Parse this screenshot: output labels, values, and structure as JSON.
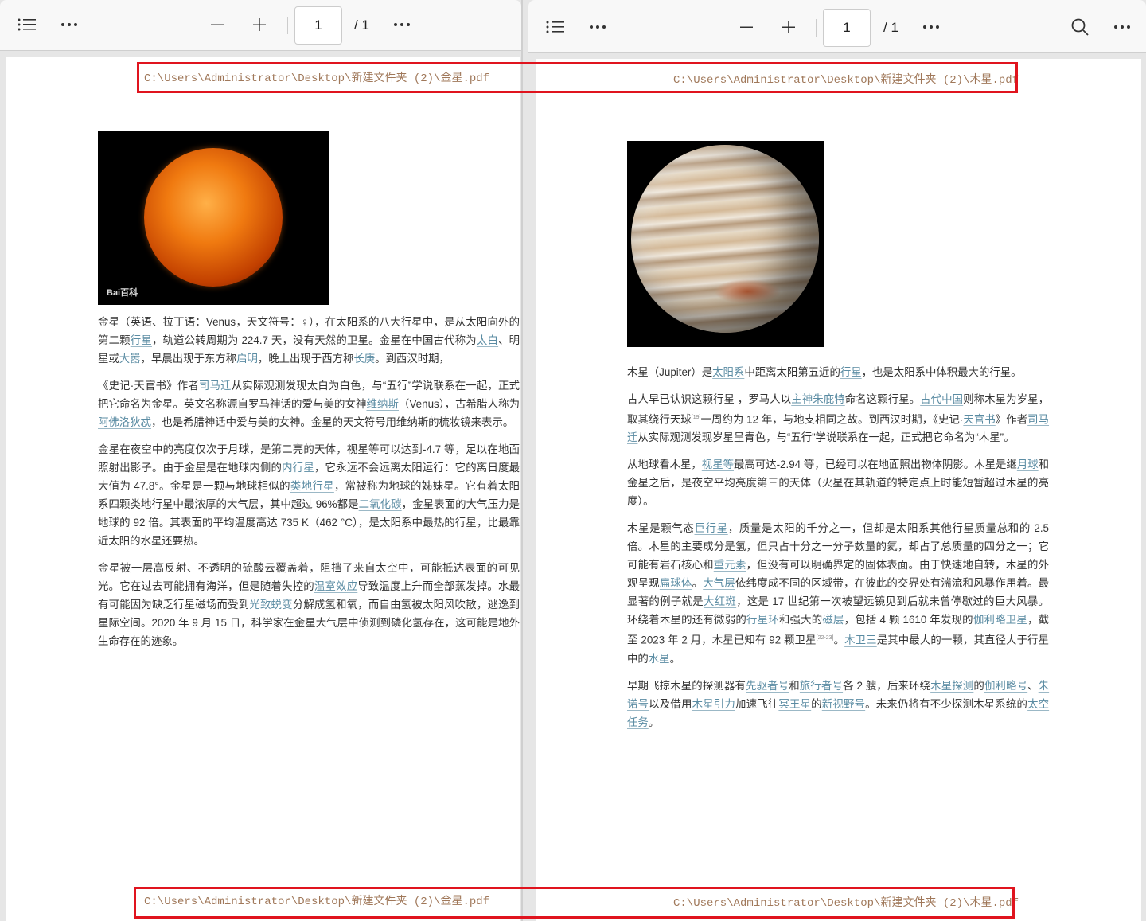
{
  "left": {
    "toolbar": {
      "page_value": "1",
      "page_total": "/ 1"
    },
    "path": "C:\\Users\\Administrator\\Desktop\\新建文件夹 (2)\\金星.pdf",
    "image_watermark": "Bai百科",
    "paragraphs": [
      [
        {
          "t": "金星（英语、拉丁语：Venus，天文符号：♀），在太阳系的八大行星中，是从太阳向外的第二颗"
        },
        {
          "t": "行星",
          "link": true
        },
        {
          "t": "，轨道公转周期为 224.7 天，没有天然的卫星。金星在中国古代称为"
        },
        {
          "t": "太白",
          "link": true
        },
        {
          "t": "、明星或"
        },
        {
          "t": "大嚣",
          "link": true
        },
        {
          "t": "，早晨出现于东方称"
        },
        {
          "t": "启明",
          "link": true
        },
        {
          "t": "，晚上出现于西方称"
        },
        {
          "t": "长庚",
          "link": true
        },
        {
          "t": "。到西汉时期，"
        }
      ],
      [
        {
          "t": "《史记·天官书》作者"
        },
        {
          "t": "司马迁",
          "link": true
        },
        {
          "t": "从实际观测发现太白为白色，与“五行”学说联系在一起，正式把它命名为金星。英文名称源自罗马神话的爱与美的女神"
        },
        {
          "t": "维纳斯",
          "link": true
        },
        {
          "t": "（Venus），古希腊人称为"
        },
        {
          "t": "阿佛洛狄忒",
          "link": true
        },
        {
          "t": "，也是希腊神话中爱与美的女神。金星的天文符号用维纳斯的梳妆镜来表示。"
        }
      ],
      [
        {
          "t": "金星在夜空中的亮度仅次于月球，是第二亮的天体，视星等可以达到-4.7 等，足以在地面照射出影子。由于金星是在地球内侧的"
        },
        {
          "t": "内行星",
          "link": true
        },
        {
          "t": "，它永远不会远离太阳运行：它的离日度最大值为 47.8°。金星是一颗与地球相似的"
        },
        {
          "t": "类地行星",
          "link": true
        },
        {
          "t": "，常被称为地球的姊妹星。它有着太阳系四颗类地行星中最浓厚的大气层，其中超过 96%都是"
        },
        {
          "t": "二氧化碳",
          "link": true
        },
        {
          "t": "，金星表面的大气压力是地球的 92 倍。其表面的平均温度高达 735 K（462 °C），是太阳系中最热的行星，比最靠近太阳的水星还要热。"
        }
      ],
      [
        {
          "t": "金星被一层高反射、不透明的硫酸云覆盖着，阻挡了来自太空中，可能抵达表面的可见光。它在过去可能拥有海洋，但是随着失控的"
        },
        {
          "t": "温室效应",
          "link": true
        },
        {
          "t": "导致温度上升而全部蒸发掉。水最有可能因为缺乏行星磁场而受到"
        },
        {
          "t": "光致蜕变",
          "link": true
        },
        {
          "t": "分解成氢和氧，而自由氢被太阳风吹散，逃逸到星际空间。2020 年 9 月 15 日，科学家在金星大气层中侦测到磷化氢存在，这可能是地外生命存在的迹象。"
        }
      ]
    ]
  },
  "right": {
    "toolbar": {
      "page_value": "1",
      "page_total": "/ 1"
    },
    "path": "C:\\Users\\Administrator\\Desktop\\新建文件夹 (2)\\木星.pdf",
    "paragraphs": [
      [
        {
          "t": "木星（Jupiter）是"
        },
        {
          "t": "太阳系",
          "link": true
        },
        {
          "t": "中距离太阳第五近的"
        },
        {
          "t": "行星",
          "link": true
        },
        {
          "t": "，也是太阳系中体积最大的行星。"
        }
      ],
      [
        {
          "t": "古人早已认识这颗行星 ，罗马人以"
        },
        {
          "t": "主神朱庇特",
          "link": true
        },
        {
          "t": "命名这颗行星。"
        },
        {
          "t": "古代中国",
          "link": true
        },
        {
          "t": "则称木星为岁星，取其绕行天球"
        },
        {
          "t": "[19]",
          "sup": true
        },
        {
          "t": "一周约为 12 年，与地支相同之故。到西汉时期，《史记·"
        },
        {
          "t": "天官书",
          "link": true
        },
        {
          "t": "》作者"
        },
        {
          "t": "司马迁",
          "link": true
        },
        {
          "t": "从实际观测发现岁星呈青色，与“五行”学说联系在一起，正式把它命名为“木星”。"
        }
      ],
      [
        {
          "t": "从地球看木星，"
        },
        {
          "t": "视星等",
          "link": true
        },
        {
          "t": "最高可达-2.94 等，已经可以在地面照出物体阴影。木星是继"
        },
        {
          "t": "月球",
          "link": true
        },
        {
          "t": "和金星之后，是夜空平均亮度第三的天体（火星在其轨道的特定点上时能短暂超过木星的亮度）。"
        }
      ],
      [
        {
          "t": "木星是颗气态"
        },
        {
          "t": "巨行星",
          "link": true
        },
        {
          "t": "，质量是太阳的千分之一，但却是太阳系其他行星质量总和的 2.5 倍。木星的主要成分是氢，但只占十分之一分子数量的氦，却占了总质量的四分之一；它可能有岩石核心和"
        },
        {
          "t": "重元素",
          "link": true
        },
        {
          "t": "，但没有可以明确界定的固体表面。由于快速地自转，木星的外观呈现"
        },
        {
          "t": "扁球体",
          "link": true
        },
        {
          "t": "。"
        },
        {
          "t": "大气层",
          "link": true
        },
        {
          "t": "依纬度成不同的区域带，在彼此的交界处有湍流和风暴作用着。最显著的例子就是"
        },
        {
          "t": "大红斑",
          "link": true
        },
        {
          "t": "，这是 17 世纪第一次被望远镜见到后就未曾停歇过的巨大风暴。环绕着木星的还有微弱的"
        },
        {
          "t": "行星环",
          "link": true
        },
        {
          "t": "和强大的"
        },
        {
          "t": "磁层",
          "link": true
        },
        {
          "t": "，包括 4 颗 1610 年发现的"
        },
        {
          "t": "伽利略卫星",
          "link": true
        },
        {
          "t": "，截至 2023 年 2 月，木星已知有 92 颗卫星"
        },
        {
          "t": "[22-23]",
          "sup": true
        },
        {
          "t": "。"
        },
        {
          "t": "木卫三",
          "link": true
        },
        {
          "t": "是其中最大的一颗，其直径大于行星中的"
        },
        {
          "t": "水星",
          "link": true
        },
        {
          "t": "。"
        }
      ],
      [
        {
          "t": "早期飞掠木星的探测器有"
        },
        {
          "t": "先驱者号",
          "link": true
        },
        {
          "t": "和"
        },
        {
          "t": "旅行者号",
          "link": true
        },
        {
          "t": "各 2 艘，后来环绕"
        },
        {
          "t": "木星探测",
          "link": true
        },
        {
          "t": "的"
        },
        {
          "t": "伽利略号",
          "link": true
        },
        {
          "t": "、"
        },
        {
          "t": "朱诺号",
          "link": true
        },
        {
          "t": "以及借用"
        },
        {
          "t": "木星引力",
          "link": true
        },
        {
          "t": "加速飞往"
        },
        {
          "t": "冥王星",
          "link": true
        },
        {
          "t": "的"
        },
        {
          "t": "新视野号",
          "link": true
        },
        {
          "t": "。未来仍将有不少探测木星系统的"
        },
        {
          "t": "太空任务",
          "link": true
        },
        {
          "t": "。"
        }
      ]
    ]
  },
  "colors": {
    "highlight_box": "#e0141e",
    "link": "#5b8ca3",
    "path": "#a0785a"
  }
}
